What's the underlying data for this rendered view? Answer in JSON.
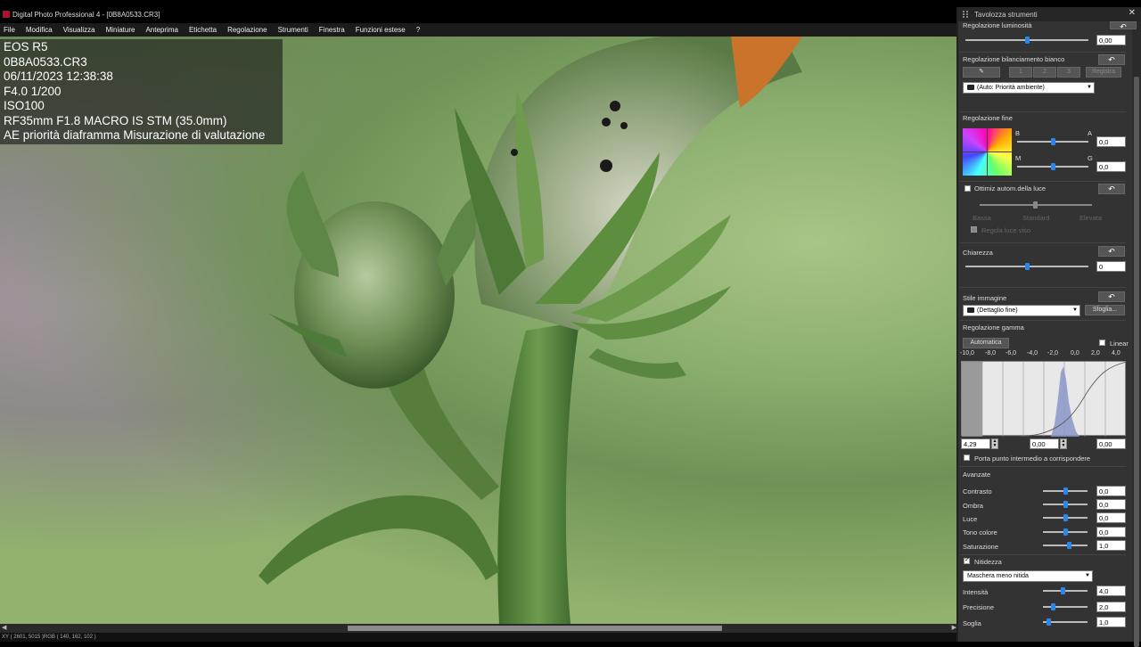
{
  "window": {
    "title": "Digital Photo Professional 4 - [0B8A0533.CR3]"
  },
  "menu": [
    "File",
    "Modifica",
    "Visualizza",
    "Miniature",
    "Anteprima",
    "Etichetta",
    "Regolazione",
    "Strumenti",
    "Finestra",
    "Funzioni estese",
    "?"
  ],
  "info": {
    "camera": "EOS R5",
    "file": "0B8A0533.CR3",
    "datetime": "06/11/2023 12:38:38",
    "exposure": "F4.0 1/200",
    "iso": "ISO100",
    "lens": "RF35mm F1.8 MACRO IS STM (35.0mm)",
    "mode": "AE priorità diaframma Misurazione di valutazione"
  },
  "statusbar": "XY ( 2601, 5015 )RGB ( 140, 162, 102 )",
  "panel": {
    "title": "Tavolozza strumenti",
    "close_icon": "close-icon",
    "brightness": {
      "label": "Regolazione luminosità",
      "value": "0,00",
      "level": 0.5
    },
    "wb": {
      "label": "Regolazione bilanciamento bianco",
      "buttons": [
        "1",
        "2",
        "3"
      ],
      "register": "Registra",
      "preset": "(Auto: Priorità ambiente)"
    },
    "finetune": {
      "label": "Regolazione fine",
      "b": "B",
      "a": "A",
      "m": "M",
      "g": "G",
      "ba_value": "0,0",
      "mg_value": "0,0"
    },
    "alo": {
      "label": "Ottimiz autom.della luce",
      "scale": [
        "Bassa",
        "Standard",
        "Elevata"
      ],
      "highlight": "Regola luce viso"
    },
    "clarity": {
      "label": "Chiarezza",
      "value": "0",
      "level": 0.5
    },
    "picture_style": {
      "label": "Stile immagine",
      "value": "(Dettaglio fine)",
      "browse": "Sfoglia..."
    },
    "gamma": {
      "label": "Regolazione gamma",
      "auto": "Automatica",
      "linear": "Linear",
      "ticks": [
        "-10,0",
        "-8,0",
        "-6,0",
        "-4,0",
        "-2,0",
        "0,0",
        "2,0",
        "4,0"
      ],
      "black": "4,29",
      "mid": "0,00",
      "white": "0,00",
      "link": "Porta punto intermedio a corrispondere"
    },
    "advanced": {
      "label": "Avanzate",
      "rows": [
        {
          "label": "Contrasto",
          "value": "0,0",
          "level": 0.5
        },
        {
          "label": "Ombra",
          "value": "0,0",
          "level": 0.5
        },
        {
          "label": "Luce",
          "value": "0,0",
          "level": 0.5
        },
        {
          "label": "Tono colore",
          "value": "0,0",
          "level": 0.5
        },
        {
          "label": "Saturazione",
          "value": "1,0",
          "level": 0.6
        }
      ]
    },
    "sharpness": {
      "label": "Nitidezza",
      "mode": "Maschera meno nitida",
      "rows": [
        {
          "label": "Intensità",
          "value": "4,0",
          "level": 0.45
        },
        {
          "label": "Precisione",
          "value": "2,0",
          "level": 0.2
        },
        {
          "label": "Soglia",
          "value": "1,0",
          "level": 0.1
        }
      ]
    }
  }
}
